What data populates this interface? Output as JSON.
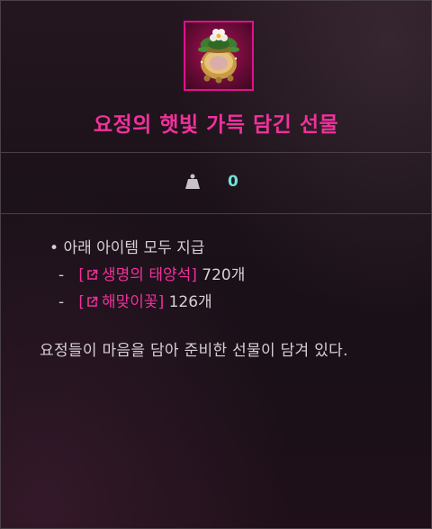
{
  "item": {
    "name": "요정의 햇빛 가득 담긴 선물",
    "icon": "flower-pot-gift-icon"
  },
  "weight": {
    "icon": "weight-icon",
    "value": "0"
  },
  "contents": {
    "heading": "아래 아이템 모두 지급",
    "items": [
      {
        "name": "생명의 태양석",
        "quantity": "720개"
      },
      {
        "name": "해맞이꽃",
        "quantity": "126개"
      }
    ]
  },
  "description": "요정들이 마음을 담아 준비한 선물이 담겨 있다.",
  "colors": {
    "title": "#f0319b",
    "link": "#f0319b",
    "weight_value": "#73e1d8",
    "text": "#d6d0d4",
    "icon_border": "#e0108c"
  }
}
